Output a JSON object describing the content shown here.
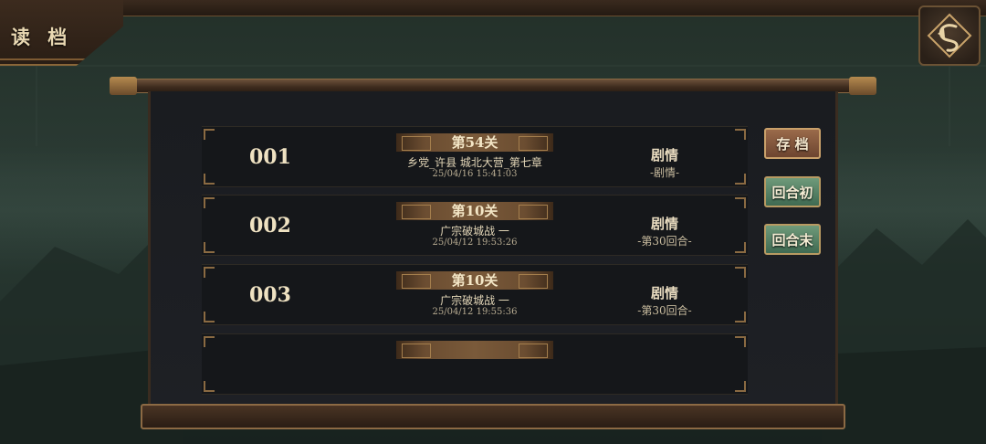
{
  "page_title": "读 档",
  "back_button_icon": "back-arrow-icon",
  "slots": [
    {
      "number": "001",
      "stage": "第54关",
      "name": "乡党_许县 城北大营_第七章",
      "time": "25/04/16 15:41:03",
      "mode": "剧情",
      "mode_sub": "-剧情-"
    },
    {
      "number": "002",
      "stage": "第10关",
      "name": "广宗破城战 一",
      "time": "25/04/12 19:53:26",
      "mode": "剧情",
      "mode_sub": "-第30回合-"
    },
    {
      "number": "003",
      "stage": "第10关",
      "name": "广宗破城战 一",
      "time": "25/04/12 19:55:36",
      "mode": "剧情",
      "mode_sub": "-第30回合-"
    },
    {
      "number": "",
      "stage": "",
      "name": "",
      "time": "",
      "mode": "",
      "mode_sub": ""
    }
  ],
  "side_buttons": {
    "save": "存 档",
    "turn_start": "回合初",
    "turn_end": "回合末"
  },
  "colors": {
    "gold_trim": "#8a6a42",
    "save_button": "#9a6a4a",
    "green_button": "#6f9a7a"
  }
}
